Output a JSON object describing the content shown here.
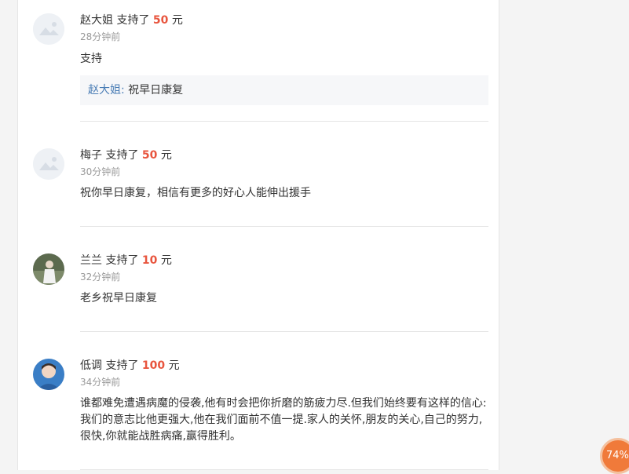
{
  "comments": [
    {
      "name": "赵大姐",
      "action": "支持了",
      "amount": "50",
      "unit": "元",
      "time": "28分钟前",
      "text": "支持",
      "avatar": "placeholder-avatar",
      "reply": {
        "name": "赵大姐:",
        "text": "祝早日康复"
      }
    },
    {
      "name": "梅子",
      "action": "支持了",
      "amount": "50",
      "unit": "元",
      "time": "30分钟前",
      "text": "祝你早日康复，相信有更多的好心人能伸出援手",
      "avatar": "placeholder-avatar"
    },
    {
      "name": "兰兰",
      "action": "支持了",
      "amount": "10",
      "unit": "元",
      "time": "32分钟前",
      "text": "老乡祝早日康复",
      "avatar": "photo-avatar-woman"
    },
    {
      "name": "低调",
      "action": "支持了",
      "amount": "100",
      "unit": "元",
      "time": "34分钟前",
      "text": "谁都难免遭遇病魔的侵袭,他有时会把你折磨的筋疲力尽.但我们始终要有这样的信心:我们的意志比他更强大,他在我们面前不值一提.家人的关怀,朋友的关心,自己的努力,很快,你就能战胜病痛,赢得胜利。",
      "avatar": "photo-avatar-man"
    }
  ],
  "progress_badge": {
    "label": "74%",
    "value": 0.74
  },
  "colors": {
    "amount": "#e8553e",
    "reply_name": "#4a7db5",
    "badge": "#f07a3a"
  }
}
